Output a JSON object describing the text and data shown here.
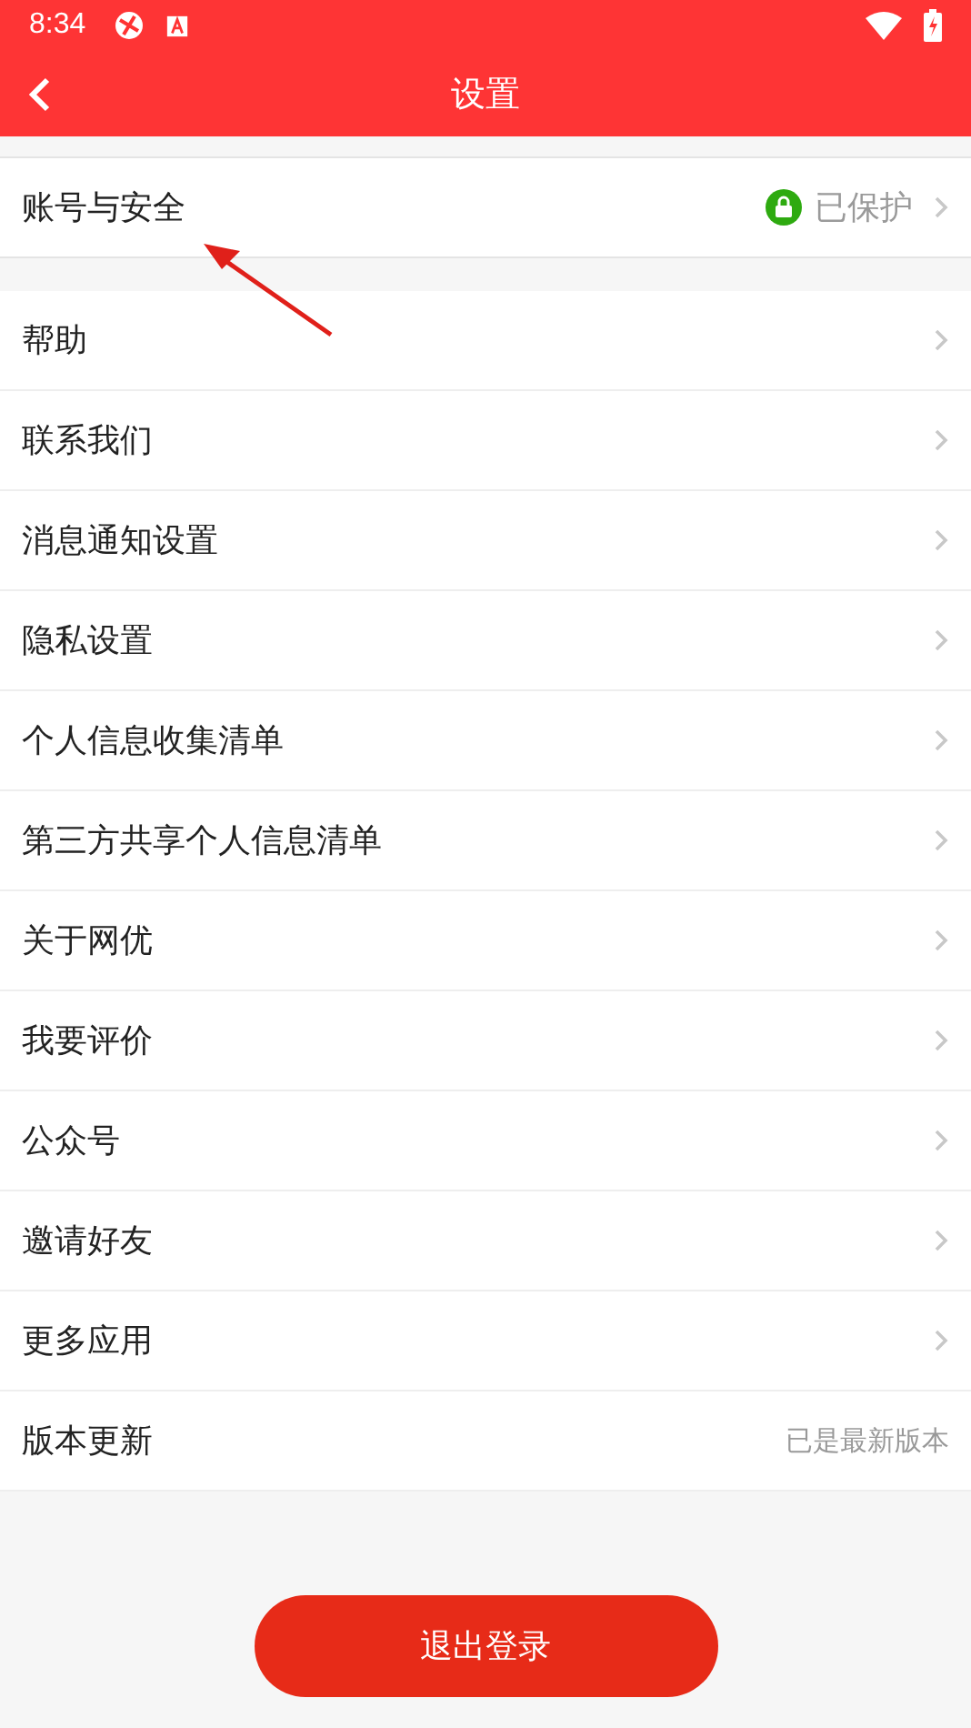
{
  "status_bar": {
    "time": "8:34"
  },
  "header": {
    "title": "设置"
  },
  "account": {
    "label": "账号与安全",
    "status": "已保护",
    "protected": true
  },
  "items": [
    {
      "kind": "link",
      "label": "帮助"
    },
    {
      "kind": "link",
      "label": "联系我们"
    },
    {
      "kind": "link",
      "label": "消息通知设置"
    },
    {
      "kind": "link",
      "label": "隐私设置"
    },
    {
      "kind": "link",
      "label": "个人信息收集清单"
    },
    {
      "kind": "link",
      "label": "第三方共享个人信息清单"
    },
    {
      "kind": "link",
      "label": "关于网优"
    },
    {
      "kind": "link",
      "label": "我要评价"
    },
    {
      "kind": "link",
      "label": "公众号"
    },
    {
      "kind": "link",
      "label": "邀请好友"
    },
    {
      "kind": "link",
      "label": "更多应用"
    },
    {
      "kind": "value",
      "label": "版本更新",
      "value": "已是最新版本"
    }
  ],
  "logout_button": "退出登录"
}
